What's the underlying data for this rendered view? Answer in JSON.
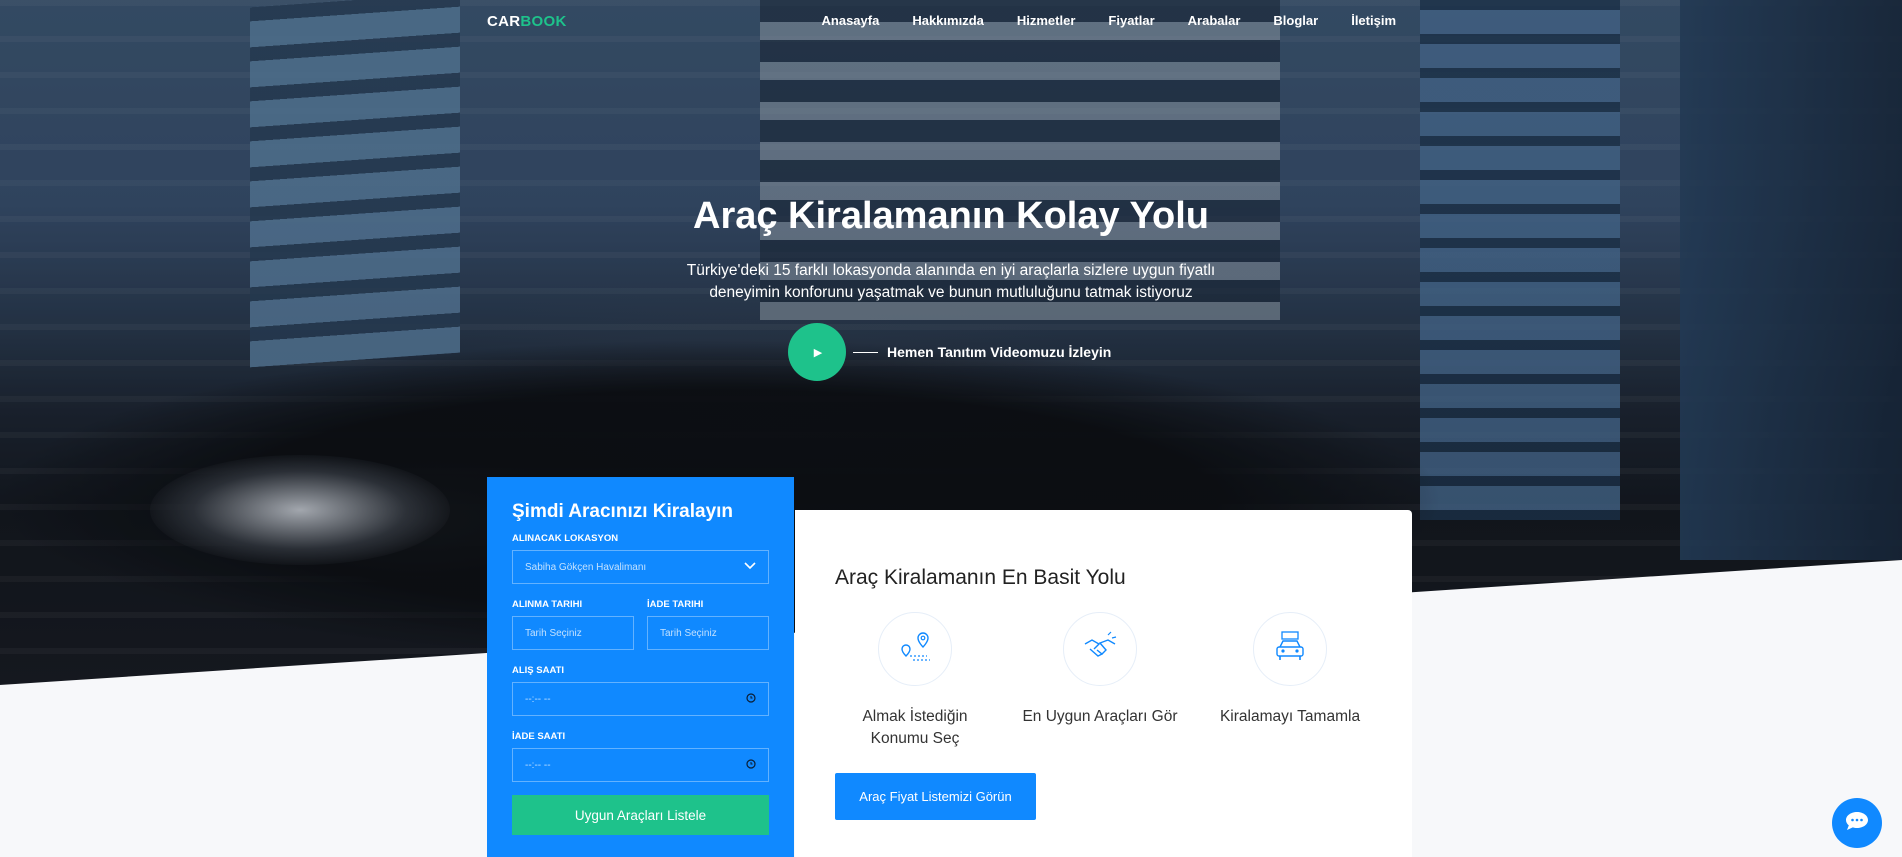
{
  "brand": {
    "part1": "CAR",
    "part2": "BOOK"
  },
  "nav": {
    "items": [
      {
        "label": "Anasayfa"
      },
      {
        "label": "Hakkımızda"
      },
      {
        "label": "Hizmetler"
      },
      {
        "label": "Fiyatlar"
      },
      {
        "label": "Arabalar"
      },
      {
        "label": "Bloglar"
      },
      {
        "label": "İletişim"
      }
    ]
  },
  "hero": {
    "title": "Araç Kiralamanın Kolay Yolu",
    "subtitle": "Türkiye'deki 15 farklı lokasyonda alanında en iyi araçlarla sizlere uygun fiyatlı deneyimin konforunu yaşatmak ve bunun mutluluğunu tatmak istiyoruz",
    "video_label": "Hemen Tanıtım Videomuzu İzleyin",
    "play_icon": "play-icon"
  },
  "booking": {
    "title": "Şimdi Aracınızı Kiralayın",
    "location_label": "ALINACAK LOKASYON",
    "location_value": "Sabiha Gökçen Havalimanı",
    "pickup_date_label": "ALINMA TARIHI",
    "pickup_date_placeholder": "Tarih Seçiniz",
    "return_date_label": "İADE TARIHI",
    "return_date_placeholder": "Tarih Seçiniz",
    "pickup_time_label": "ALIŞ SAATI",
    "pickup_time_value": "--:-- --",
    "return_time_label": "İADE SAATI",
    "return_time_value": "--:-- --",
    "submit_label": "Uygun Araçları Listele"
  },
  "steps": {
    "title": "Araç Kiralamanın En Basit Yolu",
    "items": [
      {
        "label": "Almak İstediğin Konumu Seç",
        "icon": "location-route-icon"
      },
      {
        "label": "En Uygun Araçları Gör",
        "icon": "handshake-icon"
      },
      {
        "label": "Kiralamayı Tamamla",
        "icon": "rent-car-icon"
      }
    ],
    "cta_label": "Araç Fiyat Listemizi Görün"
  },
  "colors": {
    "primary": "#1089ff",
    "accent": "#1ec28b",
    "background": "#f7f8fa"
  }
}
